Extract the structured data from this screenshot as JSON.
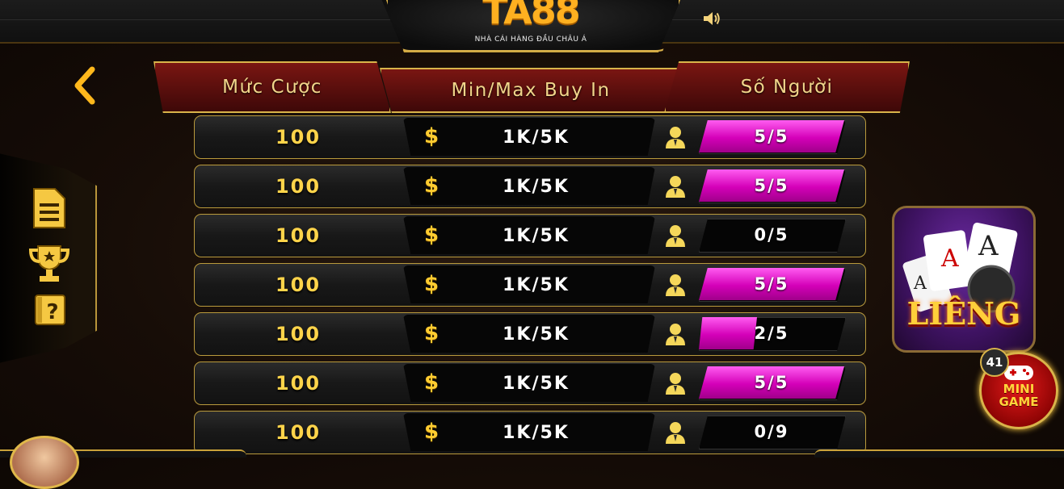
{
  "header": {
    "logo_text": "TA88",
    "logo_tagline": "NHÀ CÁI HÀNG ĐẦU CHÂU Á",
    "sound_icon": "speaker-icon"
  },
  "nav": {
    "back_icon": "chevron-left-icon"
  },
  "side_menu": {
    "items": [
      {
        "icon": "document-icon"
      },
      {
        "icon": "trophy-icon"
      },
      {
        "icon": "help-icon"
      }
    ]
  },
  "table_header": {
    "bet_level": "Mức Cược",
    "buy_in": "Min/Max Buy In",
    "players": "Số Người"
  },
  "rooms": [
    {
      "bet": "100",
      "buy_in": "1K/5K",
      "players": "5/5",
      "fill": 1.0
    },
    {
      "bet": "100",
      "buy_in": "1K/5K",
      "players": "5/5",
      "fill": 1.0
    },
    {
      "bet": "100",
      "buy_in": "1K/5K",
      "players": "0/5",
      "fill": 0.0
    },
    {
      "bet": "100",
      "buy_in": "1K/5K",
      "players": "5/5",
      "fill": 1.0
    },
    {
      "bet": "100",
      "buy_in": "1K/5K",
      "players": "2/5",
      "fill": 0.4
    },
    {
      "bet": "100",
      "buy_in": "1K/5K",
      "players": "5/5",
      "fill": 1.0
    },
    {
      "bet": "100",
      "buy_in": "1K/5K",
      "players": "0/9",
      "fill": 0.0
    }
  ],
  "game_card": {
    "title": "LIÊNG"
  },
  "mini_game": {
    "badge": "41",
    "label_line1": "MINI",
    "label_line2": "GAME"
  },
  "colors": {
    "gold": "#d9b44a",
    "magenta": "#e010c8",
    "header_red": "#7a1612"
  }
}
